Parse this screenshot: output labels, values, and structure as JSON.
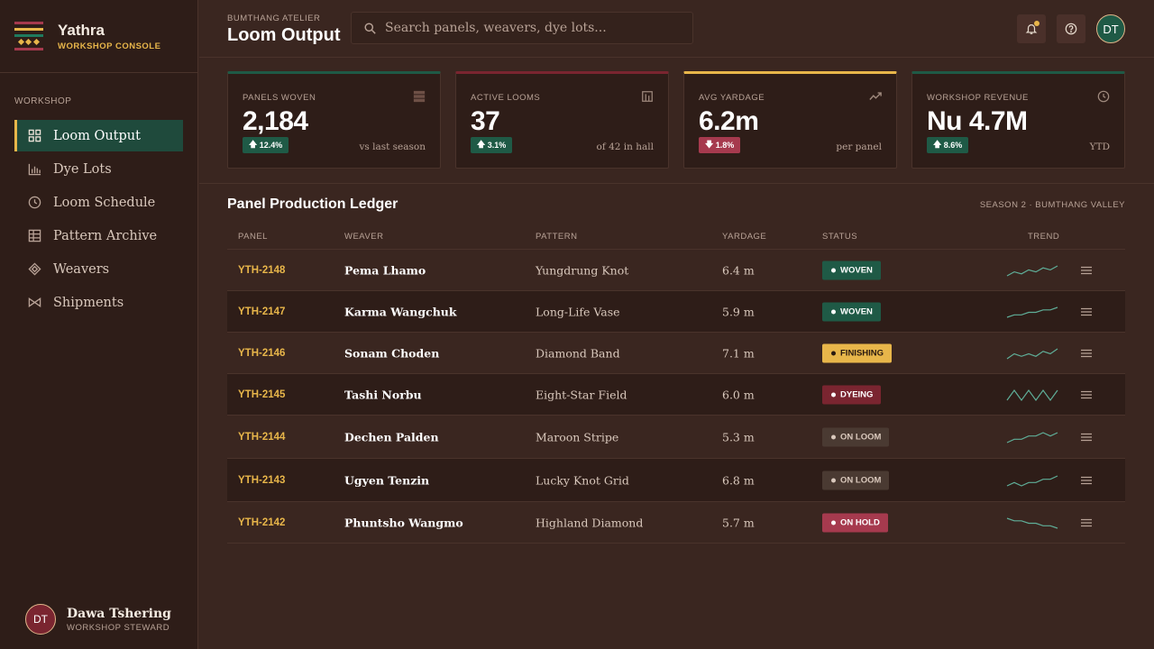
{
  "colors": {
    "accent": "#e8b64a",
    "green": "#1f5a46",
    "maroon": "#7a2530",
    "rose": "#a63a4e",
    "bg": "#3a2620"
  },
  "brand": {
    "name": "Yathra",
    "subtitle": "WORKSHOP CONSOLE"
  },
  "sidebar": {
    "section": "WORKSHOP",
    "items": [
      {
        "label": "Loom Output",
        "icon": "grid-icon",
        "active": true
      },
      {
        "label": "Dye Lots",
        "icon": "bar-chart-icon"
      },
      {
        "label": "Loom Schedule",
        "icon": "clock-icon"
      },
      {
        "label": "Pattern Archive",
        "icon": "table-icon"
      },
      {
        "label": "Weavers",
        "icon": "diamond-icon"
      },
      {
        "label": "Shipments",
        "icon": "bowtie-icon"
      }
    ],
    "user": {
      "initials": "DT",
      "name": "Dawa Tshering",
      "role": "WORKSHOP STEWARD"
    }
  },
  "header": {
    "breadcrumb": "BUMTHANG ATELIER",
    "title": "Loom Output",
    "search_placeholder": "Search panels, weavers, dye lots...",
    "avatar_initials": "DT"
  },
  "kpis": [
    {
      "label": "PANELS WOVEN",
      "value": "2,184",
      "delta": "12.4%",
      "direction": "up",
      "note": "vs last season",
      "icon": "loom-icon",
      "accent": "#1f5a46"
    },
    {
      "label": "ACTIVE LOOMS",
      "value": "37",
      "delta": "3.1%",
      "direction": "up",
      "note": "of 42 in hall",
      "icon": "columns-icon",
      "accent": "#7a2530"
    },
    {
      "label": "AVG YARDAGE",
      "value": "6.2m",
      "delta": "1.8%",
      "direction": "down",
      "note": "per panel",
      "icon": "trend-icon",
      "accent": "#e8b64a"
    },
    {
      "label": "WORKSHOP REVENUE",
      "value": "Nu 4.7M",
      "delta": "8.6%",
      "direction": "up",
      "note": "YTD",
      "icon": "clock-icon",
      "accent": "#1f5a46"
    }
  ],
  "ledger": {
    "title": "Panel Production Ledger",
    "meta": "SEASON 2 · BUMTHANG VALLEY",
    "columns": [
      "PANEL",
      "WEAVER",
      "PATTERN",
      "YARDAGE",
      "STATUS",
      "TREND"
    ],
    "rows": [
      {
        "id": "YTH-2148",
        "weaver": "Pema Lhamo",
        "pattern": "Yungdrung Knot",
        "yardage": "6.4 m",
        "status": "WOVEN",
        "status_kind": "woven",
        "trend": [
          3,
          5,
          4,
          6,
          5,
          7,
          6,
          8
        ]
      },
      {
        "id": "YTH-2147",
        "weaver": "Karma Wangchuk",
        "pattern": "Long-Life Vase",
        "yardage": "5.9 m",
        "status": "WOVEN",
        "status_kind": "woven",
        "trend": [
          3,
          4,
          4,
          5,
          5,
          6,
          6,
          7
        ]
      },
      {
        "id": "YTH-2146",
        "weaver": "Sonam Choden",
        "pattern": "Diamond Band",
        "yardage": "7.1 m",
        "status": "FINISHING",
        "status_kind": "finishing",
        "trend": [
          4,
          6,
          5,
          6,
          5,
          7,
          6,
          8
        ]
      },
      {
        "id": "YTH-2145",
        "weaver": "Tashi Norbu",
        "pattern": "Eight-Star Field",
        "yardage": "6.0 m",
        "status": "DYEING",
        "status_kind": "dyeing",
        "trend": [
          5,
          6,
          5,
          6,
          5,
          6,
          5,
          6
        ]
      },
      {
        "id": "YTH-2144",
        "weaver": "Dechen Palden",
        "pattern": "Maroon Stripe",
        "yardage": "5.3 m",
        "status": "ON LOOM",
        "status_kind": "loom",
        "trend": [
          3,
          4,
          4,
          5,
          5,
          6,
          5,
          6
        ]
      },
      {
        "id": "YTH-2143",
        "weaver": "Ugyen Tenzin",
        "pattern": "Lucky Knot Grid",
        "yardage": "6.8 m",
        "status": "ON LOOM",
        "status_kind": "loom",
        "trend": [
          4,
          5,
          4,
          5,
          5,
          6,
          6,
          7
        ]
      },
      {
        "id": "YTH-2142",
        "weaver": "Phuntsho Wangmo",
        "pattern": "Highland Diamond",
        "yardage": "5.7 m",
        "status": "ON HOLD",
        "status_kind": "hold",
        "trend": [
          7,
          6,
          6,
          5,
          5,
          4,
          4,
          3
        ]
      }
    ]
  }
}
